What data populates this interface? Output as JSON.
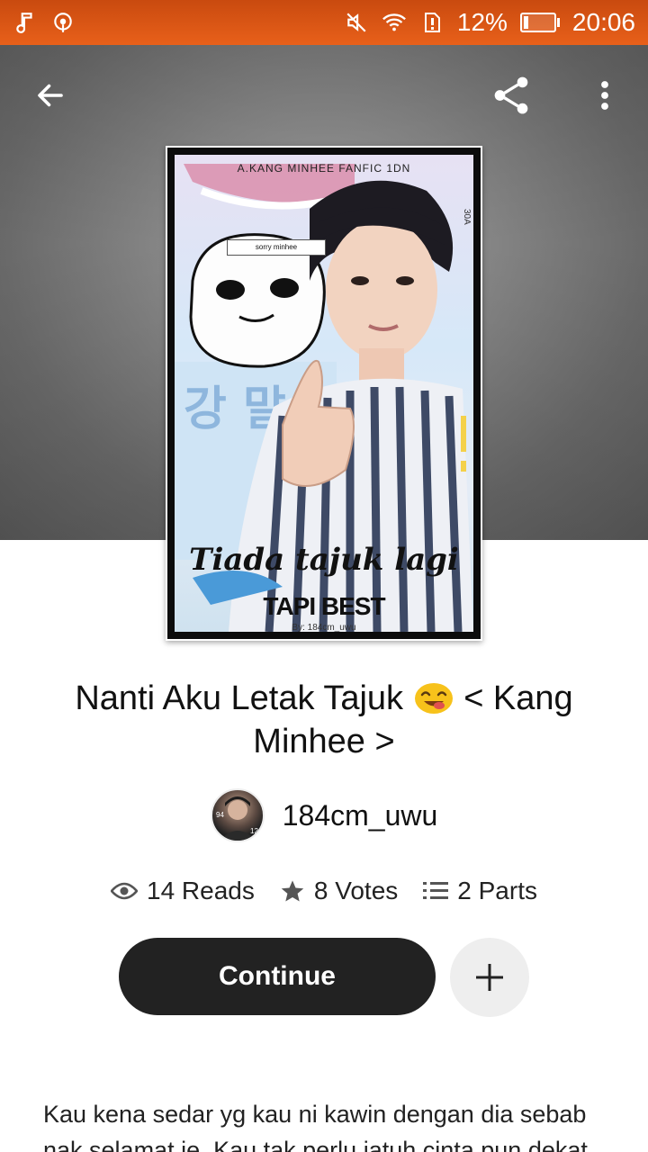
{
  "status_bar": {
    "battery": "12%",
    "time": "20:06",
    "icons": [
      "music-note-icon",
      "podcast-icon",
      "mute-icon",
      "wifi-icon",
      "sim-alert-icon",
      "battery-charging-icon"
    ]
  },
  "topbar": {
    "icons": [
      "back-arrow-icon",
      "share-icon",
      "more-vert-icon"
    ]
  },
  "cover": {
    "top_text": "A.KANG MINHEE FANFIC 1DN",
    "speech": "sorry minhee",
    "title": "Tiada tajuk lagi",
    "subtitle": "TAPI BEST",
    "by": "By: 184cm_uwu"
  },
  "story": {
    "title_part1": "Nanti Aku Letak Tajuk",
    "title_part2": "< Kang Minhee >",
    "title_emoji": "savoring-face-emoji"
  },
  "author": {
    "name": "184cm_uwu"
  },
  "stats": {
    "reads": "14 Reads",
    "votes": "8 Votes",
    "parts": "2 Parts"
  },
  "actions": {
    "continue_label": "Continue"
  },
  "description": "Kau kena sedar yg kau ni kawin dengan dia sebab nak selamat je. Kau tak perlu jatuh cinta pun dekat",
  "colors": {
    "status_bar": "#e8601a",
    "continue_bg": "#222222",
    "add_bg": "#eeeeee"
  }
}
